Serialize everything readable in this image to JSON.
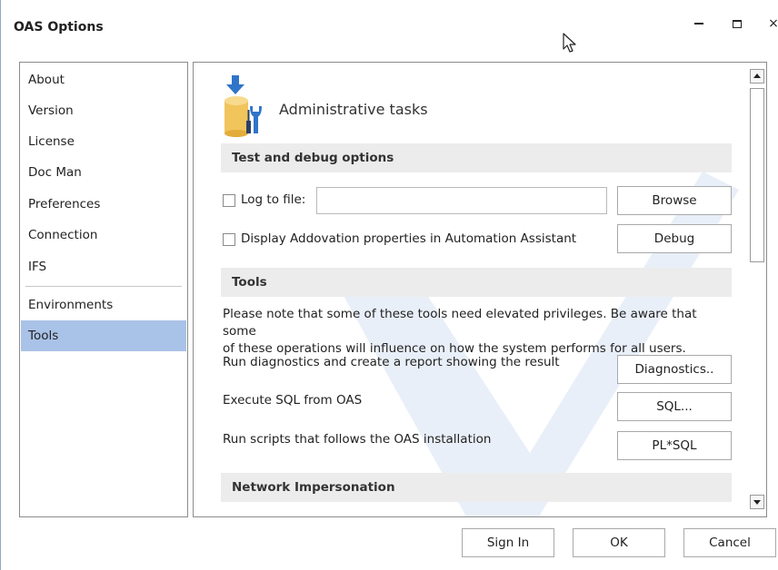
{
  "window": {
    "title": "OAS Options",
    "controls": {
      "minimize": "minimize",
      "maximize": "maximize",
      "close": "×"
    }
  },
  "sidebar": {
    "items": [
      {
        "label": "About"
      },
      {
        "label": "Version"
      },
      {
        "label": "License"
      },
      {
        "label": "Doc Man"
      },
      {
        "label": "Preferences"
      },
      {
        "label": "Connection"
      },
      {
        "label": "IFS"
      },
      {
        "label": "Environments"
      },
      {
        "label": "Tools",
        "selected": true
      }
    ]
  },
  "main": {
    "header": {
      "title": "Administrative tasks",
      "icon": "admin-tasks-icon"
    },
    "test_debug": {
      "section_title": "Test and debug options",
      "log_to_file": {
        "label": "Log to file:",
        "checked": false,
        "value": ""
      },
      "browse_label": "Browse",
      "display_props": {
        "label": "Display Addovation properties in Automation Assistant",
        "checked": false
      },
      "debug_label": "Debug"
    },
    "tools": {
      "section_title": "Tools",
      "note_line1": "Please note that some of these tools need elevated privileges. Be aware that some",
      "note_line2": "of these operations will influence on how the system performs for all users.",
      "diagnostics": {
        "text": "Run diagnostics and create a report showing the result",
        "button": "Diagnostics.."
      },
      "sql": {
        "text": "Execute SQL from OAS",
        "button": "SQL..."
      },
      "plsql": {
        "text": "Run scripts that follows the OAS installation",
        "button": "PL*SQL"
      }
    },
    "network": {
      "section_title": "Network Impersonation"
    }
  },
  "footer": {
    "sign_in": "Sign In",
    "ok": "OK",
    "cancel": "Cancel"
  },
  "colors": {
    "selected_nav": "#a9c2e7",
    "section_bg": "#ececec",
    "border": "#8c8c8c",
    "watermark": "#e8eef7"
  }
}
